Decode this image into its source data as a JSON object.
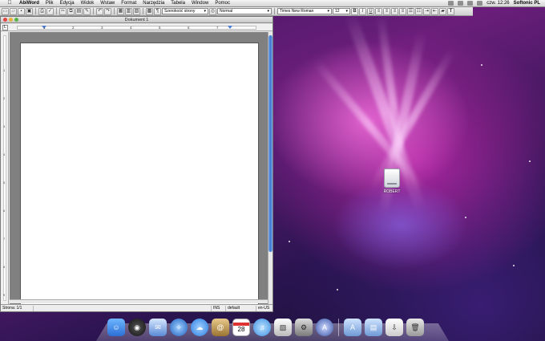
{
  "menubar": {
    "app_name": "AbiWord",
    "items": [
      "Plik",
      "Edycja",
      "Widok",
      "Wstaw",
      "Format",
      "Narzędzia",
      "Tabela",
      "Window",
      "Pomoc"
    ],
    "clock": "czw. 12:26",
    "user": "Softonic PL"
  },
  "toolbar": {
    "zoom": "Szerokość strony",
    "style": "Normal",
    "font": "Times New Roman",
    "font_size": "12"
  },
  "window": {
    "title": "Dokument 1"
  },
  "ruler": {
    "h_numbers": [
      "1",
      "2",
      "3",
      "4",
      "5",
      "6",
      "7"
    ],
    "v_numbers": [
      "1",
      "2",
      "3",
      "4",
      "5",
      "6",
      "7",
      "8",
      "9"
    ],
    "corner": "L"
  },
  "statusbar": {
    "page": "Strona: 1/1",
    "insert_mode": "INS",
    "style": "default",
    "language": "en-US"
  },
  "desktop": {
    "drive_label": "ROBERT"
  },
  "dock": {
    "calendar_day": "28"
  }
}
